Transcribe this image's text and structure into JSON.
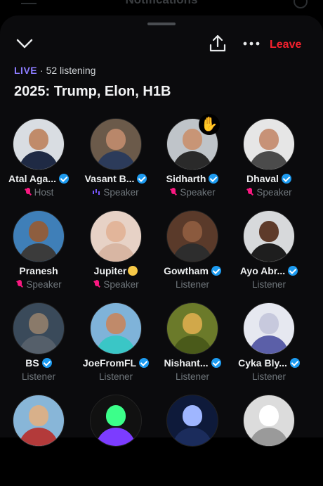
{
  "background_header": {
    "title": "Notifications"
  },
  "actions": {
    "leave_label": "Leave"
  },
  "room": {
    "live_label": "LIVE",
    "separator": "·",
    "listening": "52 listening",
    "title": "2025: Trump, Elon, H1B"
  },
  "participants": [
    {
      "name": "Atal Aga...",
      "verified": true,
      "role": "Host",
      "mic": "muted",
      "skin": "#c08b6a",
      "bg": "#d9dde2",
      "shirt": "#1f2a44"
    },
    {
      "name": "Vasant B...",
      "verified": true,
      "role": "Speaker",
      "mic": "speaking",
      "skin": "#b9876a",
      "bg": "#6b5a4a",
      "shirt": "#2c3b5a"
    },
    {
      "name": "Sidharth",
      "verified": true,
      "role": "Speaker",
      "mic": "muted",
      "skin": "#c89576",
      "bg": "#bfc4c9",
      "shirt": "#2a2a2a",
      "hand": true
    },
    {
      "name": "Dhaval",
      "verified": true,
      "role": "Speaker",
      "mic": "muted",
      "skin": "#c79277",
      "bg": "#e6e6e6",
      "shirt": "#4b4b4b"
    },
    {
      "name": "Pranesh",
      "verified": false,
      "role": "Speaker",
      "mic": "muted",
      "skin": "#8e5e3f",
      "bg": "#3f7fb8",
      "shirt": "#3b3b3b"
    },
    {
      "name": "Jupiter",
      "verified": false,
      "emoji": true,
      "role": "Speaker",
      "mic": "muted",
      "skin": "#e2b59a",
      "bg": "#e7d2c6",
      "shirt": "#d8b6a3"
    },
    {
      "name": "Gowtham",
      "verified": true,
      "role": "Listener",
      "mic": "none",
      "skin": "#8b5a3e",
      "bg": "#5a3a2a",
      "shirt": "#2d2d2d"
    },
    {
      "name": "Ayo Abr...",
      "verified": true,
      "role": "Listener",
      "mic": "none",
      "skin": "#5e3b2a",
      "bg": "#d7d9db",
      "shirt": "#1e1e1e"
    },
    {
      "name": "BS",
      "verified": true,
      "role": "Listener",
      "mic": "none",
      "skin": "#8a7a6a",
      "bg": "#3a4a5a",
      "shirt": "#555f6a"
    },
    {
      "name": "JoeFromFL",
      "verified": true,
      "role": "Listener",
      "mic": "none",
      "skin": "#c08a6a",
      "bg": "#7fb3d9",
      "shirt": "#3ac6c6"
    },
    {
      "name": "Nishant...",
      "verified": true,
      "role": "Listener",
      "mic": "none",
      "skin": "#d1a84a",
      "bg": "#6b7a2a",
      "shirt": "#4a5a1a"
    },
    {
      "name": "Cyka Bly...",
      "verified": true,
      "role": "Listener",
      "mic": "none",
      "skin": "#c7c9dd",
      "bg": "#e6e8f0",
      "shirt": "#5b5fa8"
    },
    {
      "name": "",
      "verified": false,
      "role": "",
      "mic": "none",
      "skin": "#d8b08a",
      "bg": "#88b6d8",
      "shirt": "#b33a3a"
    },
    {
      "name": "",
      "verified": false,
      "role": "",
      "mic": "none",
      "skin": "#3cff8a",
      "bg": "#111111",
      "shirt": "#7c3cff"
    },
    {
      "name": "",
      "verified": false,
      "role": "",
      "mic": "none",
      "skin": "#9fb6ff",
      "bg": "#0e1a3a",
      "shirt": "#1b2c5c"
    },
    {
      "name": "",
      "verified": false,
      "role": "",
      "mic": "none",
      "skin": "#ffffff",
      "bg": "#dcdcdc",
      "shirt": "#9a9a9a"
    }
  ]
}
